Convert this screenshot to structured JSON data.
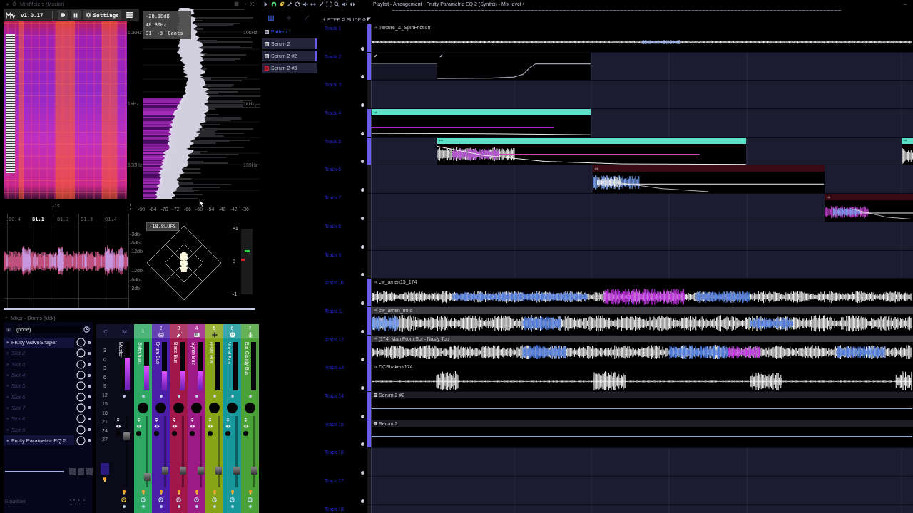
{
  "minimeters": {
    "window_title": "MiniMeters (Master)",
    "version": "v1.0.17",
    "settings_label": "Settings",
    "readout": [
      "-28.18dB",
      "48.80Hz",
      "G1 -8 Cents"
    ],
    "frequency_labels_left": [
      "10kHz",
      "1kHz",
      "100Hz"
    ],
    "frequency_labels_right": [
      "10kHz",
      "1kHz",
      "100Hz"
    ],
    "time_label": "-1s",
    "db_ticks": [
      "-90",
      "-84",
      "-78",
      "-72",
      "-66",
      "-60",
      "-54",
      "-48",
      "-42",
      "-36"
    ],
    "oscilloscope_times": [
      {
        "label": "80.4",
        "selected": false
      },
      {
        "label": "81.1",
        "selected": true
      },
      {
        "label": "81.2",
        "selected": false
      },
      {
        "label": "81.3",
        "selected": false
      },
      {
        "label": "81.4",
        "selected": false
      }
    ],
    "db_labels": [
      "-3db-",
      "-6db-",
      "-12db-",
      "-12db-",
      "-6db-",
      "-3db-"
    ],
    "loudness": "-18.8LUFS",
    "correlation_labels": [
      "+1",
      "0",
      "-1"
    ]
  },
  "mixer": {
    "title": "Mixer - Drums (kick)",
    "preset": "(none)",
    "slots": [
      {
        "label": "Fruity WaveShaper",
        "filled": true,
        "on": true
      },
      {
        "label": "Slot 2",
        "filled": false,
        "on": true
      },
      {
        "label": "Slot 3",
        "filled": false,
        "on": true
      },
      {
        "label": "Slot 4",
        "filled": false,
        "on": true
      },
      {
        "label": "Slot 5",
        "filled": false,
        "on": true
      },
      {
        "label": "Slot 6",
        "filled": false,
        "on": true
      },
      {
        "label": "Slot 7",
        "filled": false,
        "on": true
      },
      {
        "label": "Slot 8",
        "filled": false,
        "on": true
      },
      {
        "label": "Slot 9",
        "filled": false,
        "on": true
      },
      {
        "label": "Fruity Parametric EQ 2",
        "filled": true,
        "on": true
      }
    ],
    "footer_label": "Equalizer",
    "master": {
      "labels": [
        "C",
        "M"
      ],
      "name": "Master",
      "scale": [
        "3",
        "0",
        "3",
        "6",
        "9",
        "12",
        "15",
        "18",
        "21",
        "24",
        "27"
      ],
      "meter": {
        "level": 0.68
      },
      "fader": {
        "level": 0.74
      }
    },
    "channels": [
      {
        "number": "1",
        "name": "Sidechain",
        "color": "#2ea862",
        "meter": {
          "level": 0.51
        },
        "fader": {
          "level": 0.1
        }
      },
      {
        "number": "2",
        "name": "Drum Bus",
        "color": "#4a1ea6",
        "meter": {
          "level": 0.39
        },
        "fader": {
          "level": 0.2
        }
      },
      {
        "number": "3",
        "name": "Bass Bus",
        "color": "#a0184a",
        "meter": {
          "level": 0.41
        },
        "fader": {
          "level": 0.2
        }
      },
      {
        "number": "4",
        "name": "Synth Bus",
        "color": "#9c1a84",
        "meter": {
          "level": 0.41
        },
        "fader": {
          "level": 0.2
        }
      },
      {
        "number": "5",
        "name": "Riser Bus",
        "color": "#86a416",
        "fader": {
          "level": 0.2
        }
      },
      {
        "number": "6",
        "name": "Vocal Bus",
        "color": "#18989a",
        "fader": {
          "level": 0.2
        }
      },
      {
        "number": "7",
        "name": "Ear Candy Bus",
        "color": "#4aa236",
        "fader": {
          "level": 0.2
        }
      }
    ]
  },
  "playlist": {
    "breadcrumb": "Playlist - Arrangement › Fruity Parametric EQ 2 (Synths) - Mix level ›",
    "step_label": "STEP",
    "slide_label": "SLIDE",
    "patterns": [
      {
        "label": "Pattern 1",
        "selected": true,
        "marked": false,
        "color": "#b8b8c8"
      },
      {
        "label": "Serum 2",
        "selected": false,
        "marked": true,
        "color": "#d0d0d8"
      },
      {
        "label": "Serum 2 #2",
        "selected": false,
        "marked": true,
        "color": "#d0d0d8"
      },
      {
        "label": "Serum 2 #3",
        "selected": false,
        "marked": false,
        "color": "#d02030"
      }
    ],
    "tracks": [
      {
        "name": "Track 1",
        "selected": true,
        "enabled": true,
        "clips": [
          {
            "kind": "audio",
            "label": "Texture_&_SpinFriction",
            "color": "#000000"
          }
        ]
      },
      {
        "name": "Track 2",
        "selected": true,
        "enabled": true,
        "clips": [
          {
            "kind": "automation"
          },
          {
            "kind": "automation"
          }
        ]
      },
      {
        "name": "Track 3",
        "selected": false,
        "enabled": true
      },
      {
        "name": "Track 4",
        "selected": true,
        "enabled": true,
        "clips": [
          {
            "kind": "audio",
            "color": "#5ee0c8"
          }
        ]
      },
      {
        "name": "Track 5",
        "selected": true,
        "enabled": true,
        "clips": [
          {
            "kind": "audio",
            "color": "#5ee0c8"
          },
          {
            "kind": "audio",
            "color": "#5ee0c8"
          }
        ]
      },
      {
        "name": "Track 6",
        "selected": false,
        "enabled": true,
        "clips": [
          {
            "kind": "audio",
            "color": "#3a0a12"
          }
        ]
      },
      {
        "name": "Track 7",
        "selected": false,
        "enabled": true,
        "clips": [
          {
            "kind": "audio",
            "color": "#3a0a12"
          }
        ]
      },
      {
        "name": "Track 8",
        "selected": false,
        "enabled": true
      },
      {
        "name": "Track 9",
        "selected": false,
        "enabled": true
      },
      {
        "name": "Track 10",
        "selected": true,
        "enabled": true,
        "clips": [
          {
            "kind": "audio",
            "label": "cw_amen15_174",
            "color": "#000000"
          }
        ]
      },
      {
        "name": "Track 11",
        "selected": true,
        "enabled": true,
        "clips": [
          {
            "kind": "audio",
            "label": "cw_amen_mnc",
            "color": "#3c3c40"
          }
        ]
      },
      {
        "name": "Track 12",
        "selected": true,
        "enabled": true,
        "clips": [
          {
            "kind": "audio",
            "label": "[174] Man From Sol - Nasty Top",
            "color": "#3c3c40"
          }
        ]
      },
      {
        "name": "Track 13",
        "selected": true,
        "enabled": true,
        "clips": [
          {
            "kind": "audio",
            "label": "DCShakers174",
            "color": "#000000"
          }
        ]
      },
      {
        "name": "Track 14",
        "selected": true,
        "enabled": true,
        "clips": [
          {
            "kind": "pattern",
            "label": "Serum 2 #2",
            "color": "#1c1c22"
          }
        ]
      },
      {
        "name": "Track 15",
        "selected": true,
        "enabled": true,
        "clips": [
          {
            "kind": "pattern",
            "label": "Serum 2",
            "color": "#1c1c22"
          }
        ]
      },
      {
        "name": "Track 16",
        "selected": false,
        "enabled": true
      },
      {
        "name": "Track 17",
        "selected": false,
        "enabled": true
      },
      {
        "name": "Track 18",
        "selected": false
      }
    ]
  }
}
